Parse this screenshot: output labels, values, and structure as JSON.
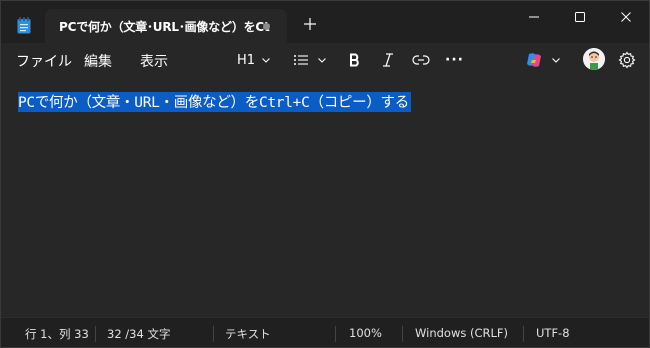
{
  "titlebar": {
    "tab_title": "PCで何か（文章･URL･画像など）をCt",
    "new_tab_label": "+"
  },
  "menu": {
    "file": "ファイル",
    "edit": "編集",
    "view": "表示"
  },
  "toolbar": {
    "heading": "H1",
    "more": "···"
  },
  "editor": {
    "selected_text": "PCで何か（文章・URL・画像など）をCtrl+C（コピー）する"
  },
  "statusbar": {
    "position": "行 1、列 33",
    "char_count": "32 /34 文字",
    "file_type": "テキスト",
    "zoom": "100%",
    "line_ending": "Windows (CRLF)",
    "encoding": "UTF-8"
  },
  "colors": {
    "background": "#272727",
    "titlebar": "#202020",
    "selection": "#0b5cc4",
    "text": "#ffffff"
  },
  "icons": [
    "notepad-icon",
    "modified-dot-icon",
    "new-tab-icon",
    "minimize-icon",
    "maximize-icon",
    "close-icon",
    "list-icon",
    "chevron-down-icon",
    "bold-icon",
    "italic-icon",
    "link-icon",
    "more-icon",
    "copilot-icon",
    "avatar",
    "settings-icon"
  ]
}
